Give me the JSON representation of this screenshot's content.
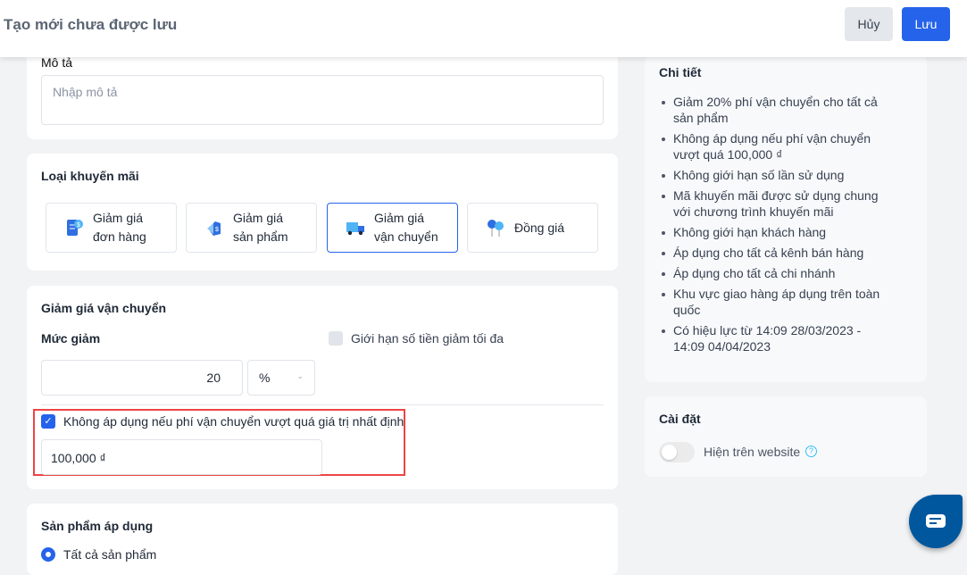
{
  "header": {
    "title": "Tạo mới chưa được lưu",
    "cancel_label": "Hủy",
    "save_label": "Lưu"
  },
  "description": {
    "label": "Mô tả",
    "placeholder": "Nhập mô tả"
  },
  "promo_type": {
    "label": "Loại khuyến mãi",
    "options": [
      {
        "line1": "Giảm giá",
        "line2": "đơn hàng",
        "icon": "receipt-dollar-icon"
      },
      {
        "line1": "Giảm giá",
        "line2": "sản phẩm",
        "icon": "price-tag-icon"
      },
      {
        "line1": "Giảm giá",
        "line2": "vận chuyển",
        "icon": "truck-icon",
        "selected": true
      },
      {
        "line1": "Đồng giá",
        "line2": "",
        "icon": "balloons-icon"
      }
    ]
  },
  "shipping": {
    "title": "Giảm giá vận chuyển",
    "discount_label": "Mức giảm",
    "discount_value": "20",
    "unit": "%",
    "max_limit_label": "Giới hạn số tiền giảm tối đa",
    "max_limit_checked": false,
    "threshold_label": "Không áp dụng nếu phí vận chuyển vượt quá giá trị nhất định",
    "threshold_checked": true,
    "threshold_value": "100,000 ₫"
  },
  "products": {
    "title": "Sản phẩm áp dụng",
    "option": "Tất cả sản phẩm"
  },
  "details": {
    "title": "Chi tiết",
    "items": [
      "Giảm 20% phí vận chuyển cho tất cả sản phẩm",
      "Không áp dụng nếu phí vận chuyển vượt quá 100,000 ₫",
      "Không giới hạn số lần sử dụng",
      "Mã khuyến mãi được sử dụng chung với chương trình khuyến mãi",
      "Không giới hạn khách hàng",
      "Áp dụng cho tất cả kênh bán hàng",
      "Áp dụng cho tất cả chi nhánh",
      "Khu vực giao hàng áp dụng trên toàn quốc",
      "Có hiệu lực từ 14:09 28/03/2023 - 14:09 04/04/2023"
    ]
  },
  "settings": {
    "title": "Cài đặt",
    "show_website_label": "Hiện trên website",
    "show_website_on": false
  },
  "colors": {
    "primary": "#2563eb",
    "highlight": "#ef4444",
    "chat": "#00579e"
  }
}
